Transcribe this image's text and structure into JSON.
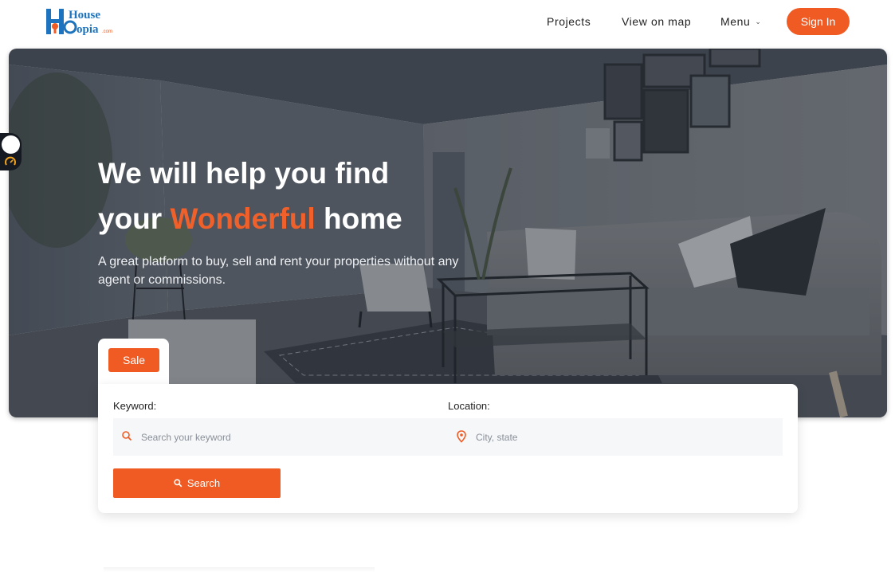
{
  "header": {
    "logo_text_top": "House",
    "logo_text_bottom": "opia",
    "logo_text_suffix": ".com",
    "nav": {
      "projects": "Projects",
      "view_on_map": "View on map",
      "menu": "Menu"
    },
    "sign_in": "Sign In"
  },
  "hero": {
    "title_line1": "We will help you find",
    "title_line2_prefix": "your ",
    "title_accent": "Wonderful",
    "title_line2_suffix": " home",
    "subtitle": "A great platform to buy, sell and rent your properties without any agent or commissions."
  },
  "search": {
    "tab_label": "Sale",
    "keyword_label": "Keyword:",
    "keyword_placeholder": "Search your keyword",
    "keyword_value": "",
    "location_label": "Location:",
    "location_placeholder": "City, state",
    "location_value": "",
    "button_label": "Search"
  },
  "colors": {
    "accent": "#ef5b23",
    "dark": "#222222",
    "logo_blue": "#1e73be"
  },
  "icons": {
    "search_field": "search-icon",
    "location_field": "map-pin-icon",
    "menu": "chevron-down-icon",
    "search_button": "search-icon"
  }
}
